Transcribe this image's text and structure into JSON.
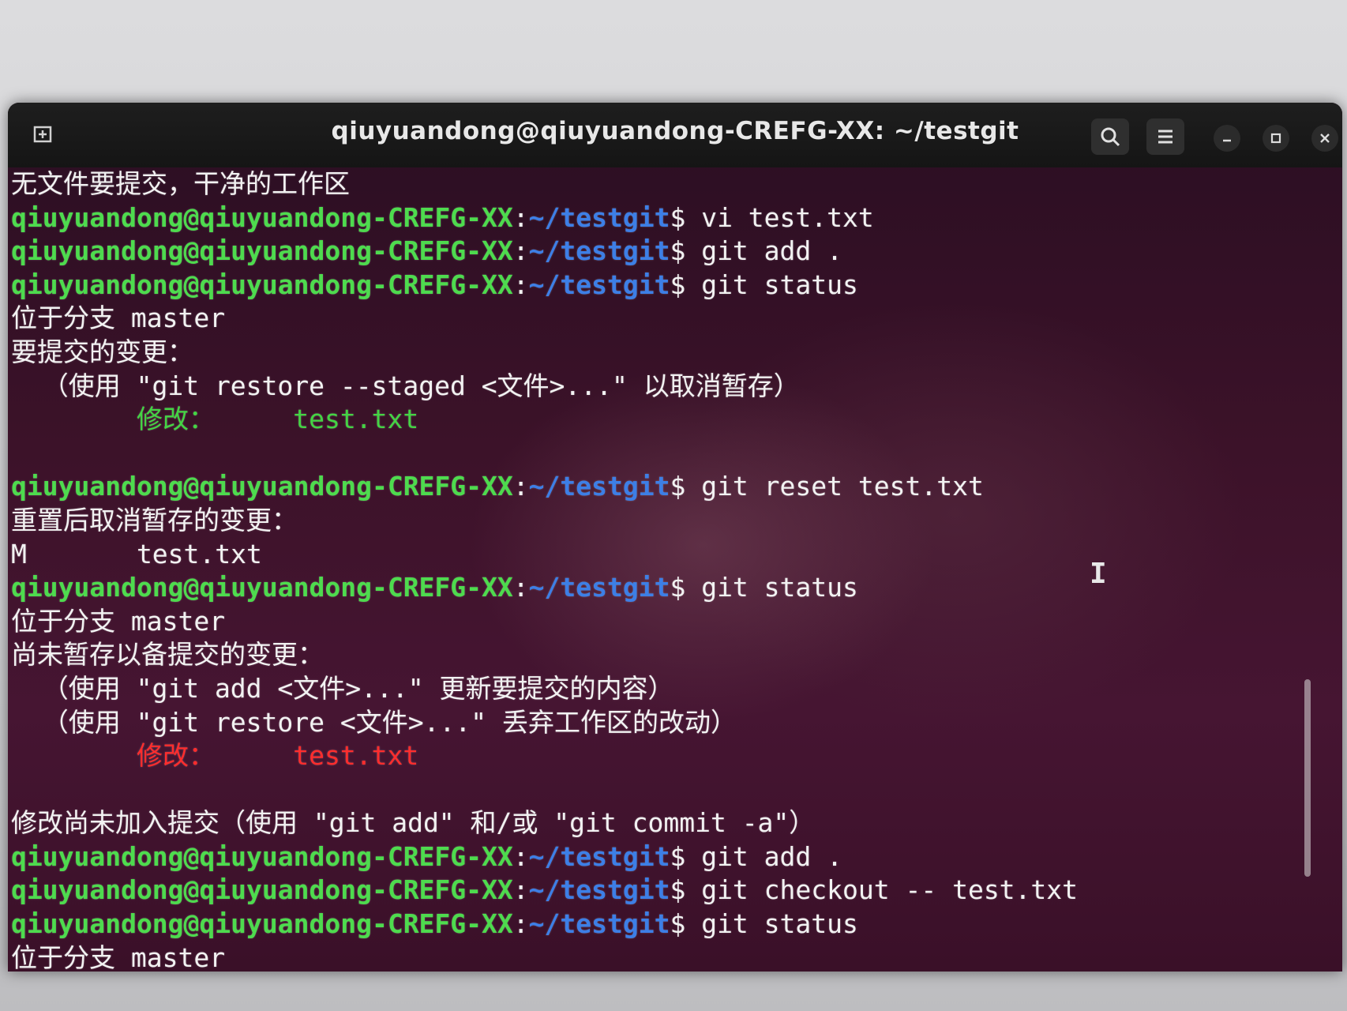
{
  "window": {
    "title": "qiuyuandong@qiuyuandong-CREFG-XX: ~/testgit",
    "buttons": {
      "new_tab_icon": "new-tab-icon",
      "search_icon": "search-icon",
      "menu_icon": "hamburger-menu-icon",
      "minimize_icon": "minimize-icon",
      "maximize_icon": "maximize-icon",
      "close_icon": "close-icon"
    }
  },
  "colors": {
    "prompt_user": "#4edb4e",
    "prompt_path": "#3d7fe6",
    "staged": "#44d444",
    "unstaged": "#ff2d2d",
    "text": "#f2f2f2"
  },
  "prompt": {
    "user_host": "qiuyuandong@qiuyuandong-CREFG-XX",
    "separator": ":",
    "path": "~/testgit",
    "dollar": "$"
  },
  "terminal": {
    "lines": [
      {
        "type": "text",
        "text": "无文件要提交，干净的工作区"
      },
      {
        "type": "prompt",
        "command": " vi test.txt"
      },
      {
        "type": "prompt",
        "command": " git add ."
      },
      {
        "type": "prompt",
        "command": " git status"
      },
      {
        "type": "text",
        "text": "位于分支 master"
      },
      {
        "type": "text",
        "text": "要提交的变更："
      },
      {
        "type": "text",
        "text": "  （使用 \"git restore --staged <文件>...\" 以取消暂存）"
      },
      {
        "type": "staged",
        "text": "        修改：     test.txt"
      },
      {
        "type": "text",
        "text": ""
      },
      {
        "type": "prompt",
        "command": " git reset test.txt"
      },
      {
        "type": "text",
        "text": "重置后取消暂存的变更："
      },
      {
        "type": "text",
        "text": "M       test.txt"
      },
      {
        "type": "prompt",
        "command": " git status"
      },
      {
        "type": "text",
        "text": "位于分支 master"
      },
      {
        "type": "text",
        "text": "尚未暂存以备提交的变更："
      },
      {
        "type": "text",
        "text": "  （使用 \"git add <文件>...\" 更新要提交的内容）"
      },
      {
        "type": "text",
        "text": "  （使用 \"git restore <文件>...\" 丢弃工作区的改动）"
      },
      {
        "type": "unstaged",
        "text": "        修改：     test.txt"
      },
      {
        "type": "text",
        "text": ""
      },
      {
        "type": "text",
        "text": "修改尚未加入提交（使用 \"git add\" 和/或 \"git commit -a\"）"
      },
      {
        "type": "prompt",
        "command": " git add ."
      },
      {
        "type": "prompt",
        "command": " git checkout -- test.txt"
      },
      {
        "type": "prompt",
        "command": " git status"
      },
      {
        "type": "text",
        "text": "位于分支 master"
      }
    ]
  }
}
